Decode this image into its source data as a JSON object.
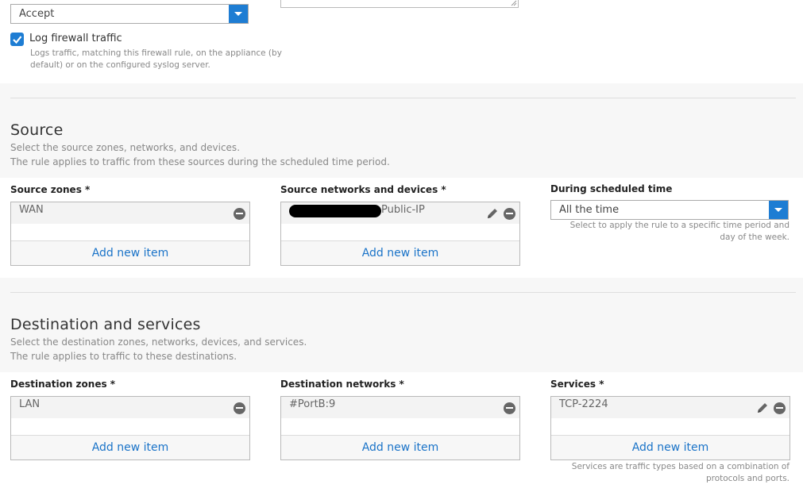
{
  "top": {
    "action_value": "Accept",
    "log_label": "Log firewall traffic",
    "log_checked": true,
    "log_desc_line1": "Logs traffic, matching this firewall rule, on the appliance (by",
    "log_desc_line2": "default) or on the configured syslog server."
  },
  "source": {
    "title": "Source",
    "desc_line1": "Select the source zones, networks, and devices.",
    "desc_line2": "The rule applies to traffic from these sources during the scheduled time period.",
    "zones_label": "Source zones *",
    "zones_item": "WAN",
    "networks_label": "Source networks and devices *",
    "networks_item": "Public-IP",
    "schedule_label": "During scheduled time",
    "schedule_value": "All the time",
    "schedule_hint_line1": "Select to apply the rule to a specific time period and",
    "schedule_hint_line2": "day of the week.",
    "add_new": "Add new item"
  },
  "destination": {
    "title": "Destination and services",
    "desc_line1": "Select the destination zones, networks, devices, and services.",
    "desc_line2": "The rule applies to traffic to these destinations.",
    "zones_label": "Destination zones *",
    "zones_item": "LAN",
    "networks_label": "Destination networks *",
    "networks_item": "#PortB:9",
    "services_label": "Services *",
    "services_item": "TCP-2224",
    "services_hint_line1": "Services are traffic types based on a combination of",
    "services_hint_line2": "protocols and ports.",
    "add_new": "Add new item"
  },
  "colors": {
    "accent": "#1e7dd3",
    "link": "#1a73c8",
    "band": "#f7f7f7"
  }
}
